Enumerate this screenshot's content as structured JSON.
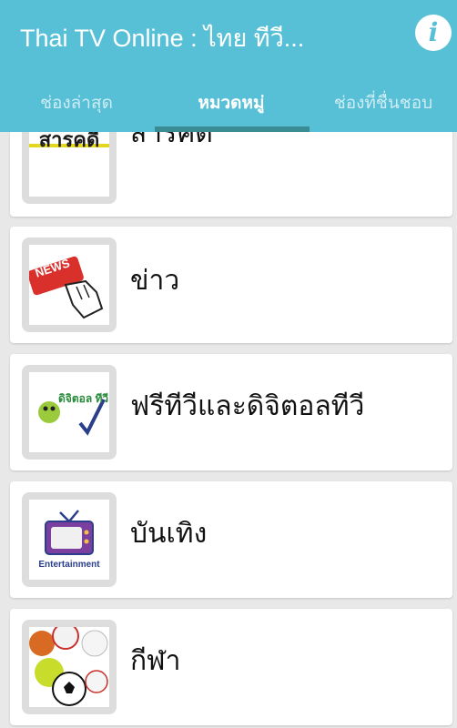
{
  "app": {
    "title": "Thai TV Online : ไทย ทีวี..."
  },
  "header": {
    "info_icon": "info-icon"
  },
  "tabs": [
    {
      "label": "ช่องล่าสุด",
      "selected": false
    },
    {
      "label": "หมวดหมู่",
      "selected": true
    },
    {
      "label": "ช่องที่ชื่นชอบ",
      "selected": false
    }
  ],
  "categories": [
    {
      "label": "สารคดี",
      "thumb_text": "สารคดี",
      "icon": "documentary-icon"
    },
    {
      "label": "ข่าว",
      "thumb_text": "NEWS",
      "icon": "news-icon"
    },
    {
      "label": "ฟรีทีวีและดิจิตอลทีวี",
      "thumb_text": "ดิจิตอล ทีวี",
      "icon": "digital-tv-icon"
    },
    {
      "label": "บันเทิง",
      "thumb_text": "Entertainment",
      "icon": "entertainment-tv-icon"
    },
    {
      "label": "กีฬา",
      "thumb_text": "",
      "icon": "sports-balls-icon"
    }
  ],
  "colors": {
    "appbar": "#57c0d6",
    "indicator": "#3a8c94",
    "background": "#e8e8e8"
  }
}
